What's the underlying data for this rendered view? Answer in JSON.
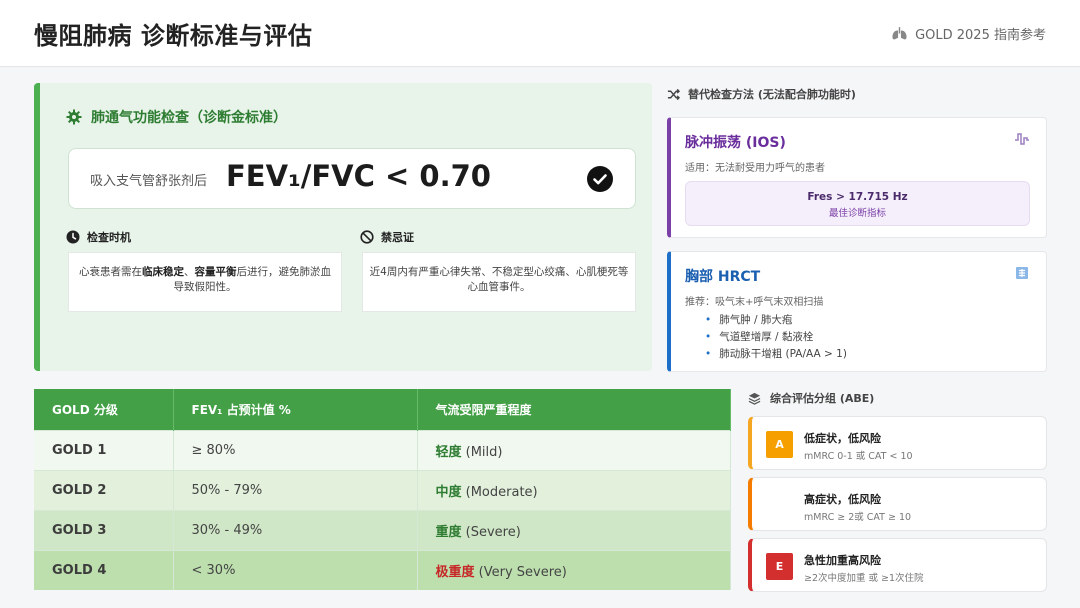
{
  "header": {
    "title": "慢阻肺病 诊断标准与评估",
    "reference": "GOLD 2025 指南参考",
    "reference_icon": "lungs-icon"
  },
  "spirometry": {
    "heading": "肺通气功能检查（诊断金标准）",
    "heading_icon": "gear-icon",
    "formula_label": "吸入支气管舒张剂后",
    "formula": "FEV₁/FVC < 0.70",
    "formula_icon": "check-circle-icon",
    "timing": {
      "label": "检查时机",
      "icon": "clock-icon",
      "text_before": "心衰患者需在",
      "text_bold_1": "临床稳定",
      "text_mid": "、",
      "text_bold_2": "容量平衡",
      "text_after": "后进行，避免肺淤血导致假阳性。"
    },
    "contraindication": {
      "label": "禁忌证",
      "icon": "ban-icon",
      "text": "近4周内有严重心律失常、不稳定型心绞痛、心肌梗死等心血管事件。"
    }
  },
  "alternatives": {
    "heading": "替代检查方法 (无法配合肺功能时)",
    "heading_icon": "shuffle-icon",
    "ios": {
      "title": "脉冲振荡 (IOS)",
      "subtitle": "适用：无法耐受用力呼气的患者",
      "value": "Fres > 17.715 Hz",
      "value_note": "最佳诊断指标",
      "icon": "waveform-icon",
      "accent": "#7b3fa8"
    },
    "hrct": {
      "title": "胸部 HRCT",
      "subtitle": "推荐：吸气末+呼气末双相扫描",
      "items": [
        "肺气肿 / 肺大疱",
        "气道壁增厚 / 黏液栓",
        "肺动脉干增粗 (PA/AA > 1)"
      ],
      "icon": "xray-icon",
      "accent": "#1e6fc7"
    }
  },
  "gold_table": {
    "headers": [
      "GOLD 分级",
      "FEV₁ 占预计值 %",
      "气流受限严重程度"
    ],
    "rows": [
      {
        "grade": "GOLD 1",
        "fev1": "≥ 80%",
        "severity": "轻度",
        "severity_en": " (Mild)"
      },
      {
        "grade": "GOLD 2",
        "fev1": "50% - 79%",
        "severity": "中度",
        "severity_en": " (Moderate)"
      },
      {
        "grade": "GOLD 3",
        "fev1": "30% - 49%",
        "severity": "重度",
        "severity_en": " (Severe)"
      },
      {
        "grade": "GOLD 4",
        "fev1": "< 30%",
        "severity": "极重度",
        "severity_en": " (Very Severe)"
      }
    ]
  },
  "abe": {
    "heading": "综合评估分组 (ABE)",
    "heading_icon": "layers-icon",
    "groups": [
      {
        "badge": "A",
        "title": "低症状，低风险",
        "desc": "mMRC 0-1 或 CAT < 10",
        "color": "#f5a000"
      },
      {
        "badge": "",
        "title": "高症状，低风险",
        "desc": "mMRC ≥ 2或 CAT ≥ 10",
        "color": "#f57c00"
      },
      {
        "badge": "E",
        "title": "急性加重高风险",
        "desc": "≥2次中度加重 或 ≥1次住院",
        "color": "#d32f2f"
      }
    ]
  }
}
